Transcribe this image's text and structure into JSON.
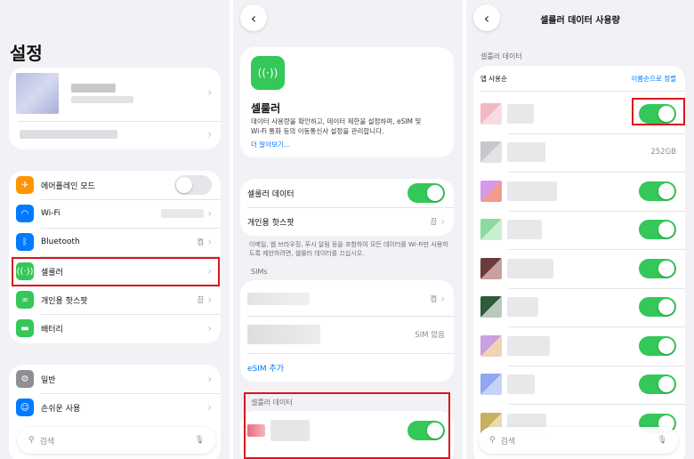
{
  "panel1": {
    "title": "설정",
    "settings": [
      {
        "label": "에어플레인 모드",
        "value": ""
      },
      {
        "label": "Wi-Fi",
        "value": ""
      },
      {
        "label": "Bluetooth",
        "value": "켬"
      },
      {
        "label": "셀룰러",
        "value": ""
      },
      {
        "label": "개인용 핫스팟",
        "value": "끔"
      },
      {
        "label": "배터리",
        "value": ""
      }
    ],
    "general": [
      {
        "label": "일반"
      },
      {
        "label": "손쉬운 사용"
      }
    ],
    "search_placeholder": "검색",
    "airplane_on": false
  },
  "panel2": {
    "hero_title": "셀룰러",
    "hero_desc": "데이터 사용량을 확인하고, 데이터 제한을 설정하며, eSIM 및 Wi-Fi 통화 등의 이동통신사 설정을 관리합니다.",
    "hero_link": "더 알아보기...",
    "cellular_data_label": "셀룰러 데이터",
    "cellular_data_on": true,
    "hotspot_label": "개인용 핫스팟",
    "hotspot_value": "끔",
    "footnote": "이메일, 웹 브라우징, 푸시 알림 등을 포함하여 모든 데이터를 Wi-Fi만 사용하도록 제한하려면, 셀룰러 데이터를 끄십시오.",
    "sims_header": "SIMs",
    "sim1_value": "켬",
    "sim2_value": "SIM 없음",
    "esim_add": "eSIM 추가",
    "bottom_header": "셀룰러 데이터"
  },
  "panel3": {
    "nav_title": "셀룰러 데이터 사용량",
    "section_header": "셀룰러 데이터",
    "sort_label": "앱 사용순",
    "sort_action": "이름순으로 정렬",
    "system_usage": "252GB",
    "search_placeholder": "검색"
  },
  "colors": {
    "green": "#34c759",
    "blue": "#007aff",
    "highlight": "#d9161c"
  }
}
